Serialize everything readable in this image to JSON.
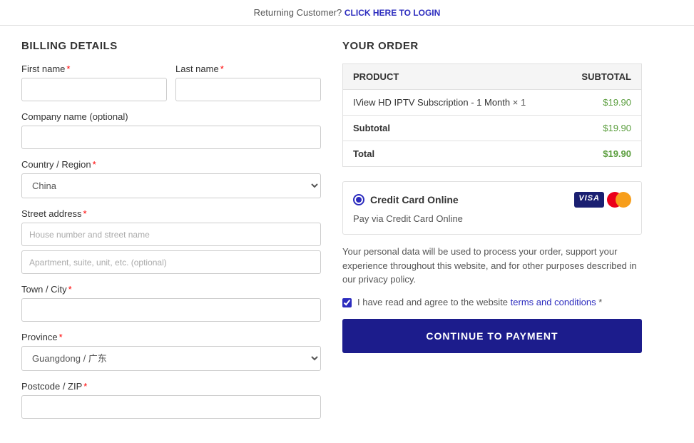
{
  "topbar": {
    "text": "Returning Customer?",
    "link_label": "Click here to login"
  },
  "billing": {
    "title": "Billing Details",
    "first_name_label": "First name",
    "last_name_label": "Last name",
    "company_label": "Company name (optional)",
    "country_label": "Country / Region",
    "country_value": "China",
    "street_label": "Street address",
    "street_placeholder1": "House number and street name",
    "street_placeholder2": "Apartment, suite, unit, etc. (optional)",
    "city_label": "Town / City",
    "province_label": "Province",
    "province_value": "Guangdong / 广东",
    "postcode_label": "Postcode / ZIP"
  },
  "order": {
    "title": "Your Order",
    "col_product": "Product",
    "col_subtotal": "Subtotal",
    "product_name": "IView HD IPTV Subscription - 1 Month",
    "product_qty": "× 1",
    "product_subtotal": "$19.90",
    "subtotal_label": "Subtotal",
    "subtotal_value": "$19.90",
    "total_label": "Total",
    "total_value": "$19.90"
  },
  "payment": {
    "method_label": "Credit Card Online",
    "description": "Pay via Credit Card Online",
    "visa_label": "VISA",
    "privacy_text": "Your personal data will be used to process your order, support your experience throughout this website, and for other purposes described in our privacy policy.",
    "agree_prefix": "I have read and agree to the website",
    "agree_link": "terms and conditions",
    "agree_suffix": "*"
  },
  "cta": {
    "button_label": "Continue to Payment"
  }
}
